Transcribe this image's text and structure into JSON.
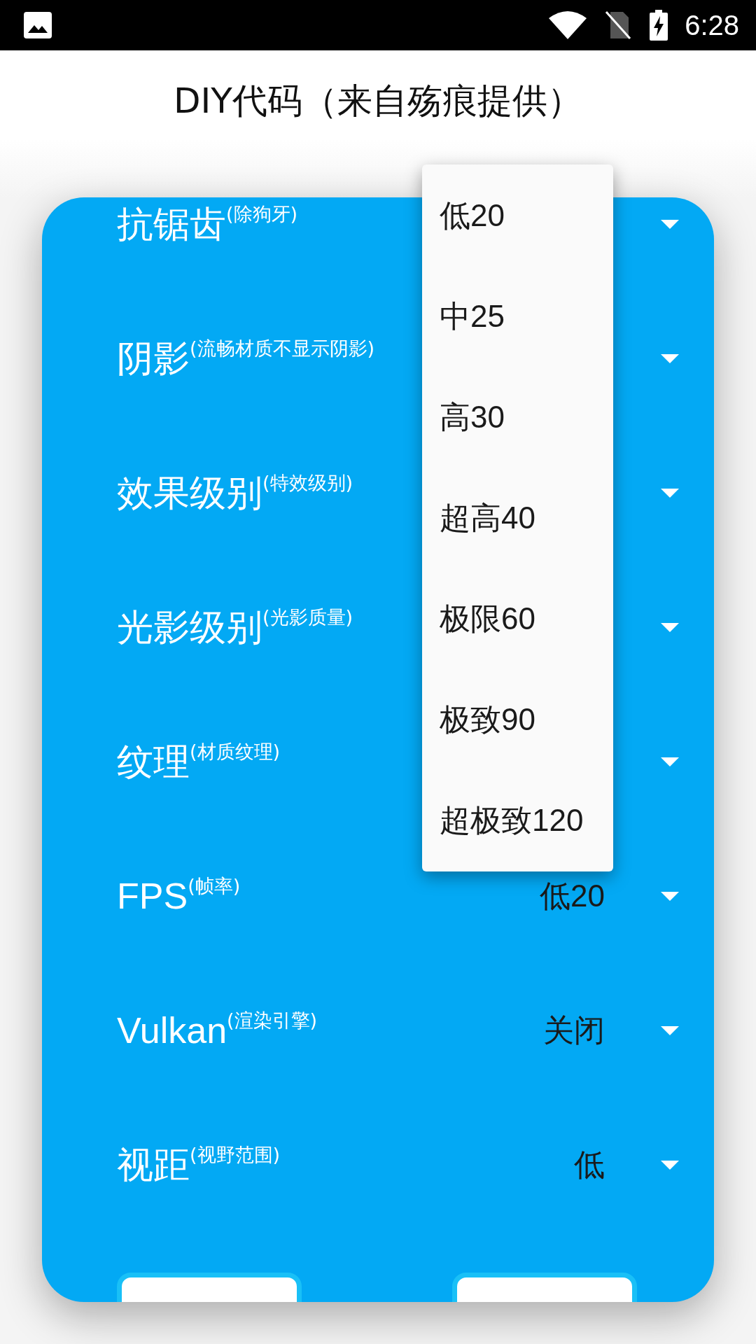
{
  "status_bar": {
    "time": "6:28"
  },
  "title": "DIY代码（来自殇痕提供）",
  "settings": [
    {
      "label": "抗锯齿",
      "note": "(除狗牙)"
    },
    {
      "label": "阴影",
      "note": "(流畅材质不显示阴影)"
    },
    {
      "label": "效果级别",
      "note": "(特效级别)"
    },
    {
      "label": "光影级别",
      "note": "(光影质量)"
    },
    {
      "label": "纹理",
      "note": "(材质纹理)"
    },
    {
      "label": "FPS",
      "note": "(帧率)",
      "value": "低20"
    },
    {
      "label": "Vulkan",
      "note": "(渲染引擎)",
      "value": "关闭"
    },
    {
      "label": "视距",
      "note": "(视野范围)",
      "value": "低"
    }
  ],
  "dropdown_menu": {
    "options": [
      "低20",
      "中25",
      "高30",
      "超高40",
      "极限60",
      "极致90",
      "超极致120"
    ]
  }
}
